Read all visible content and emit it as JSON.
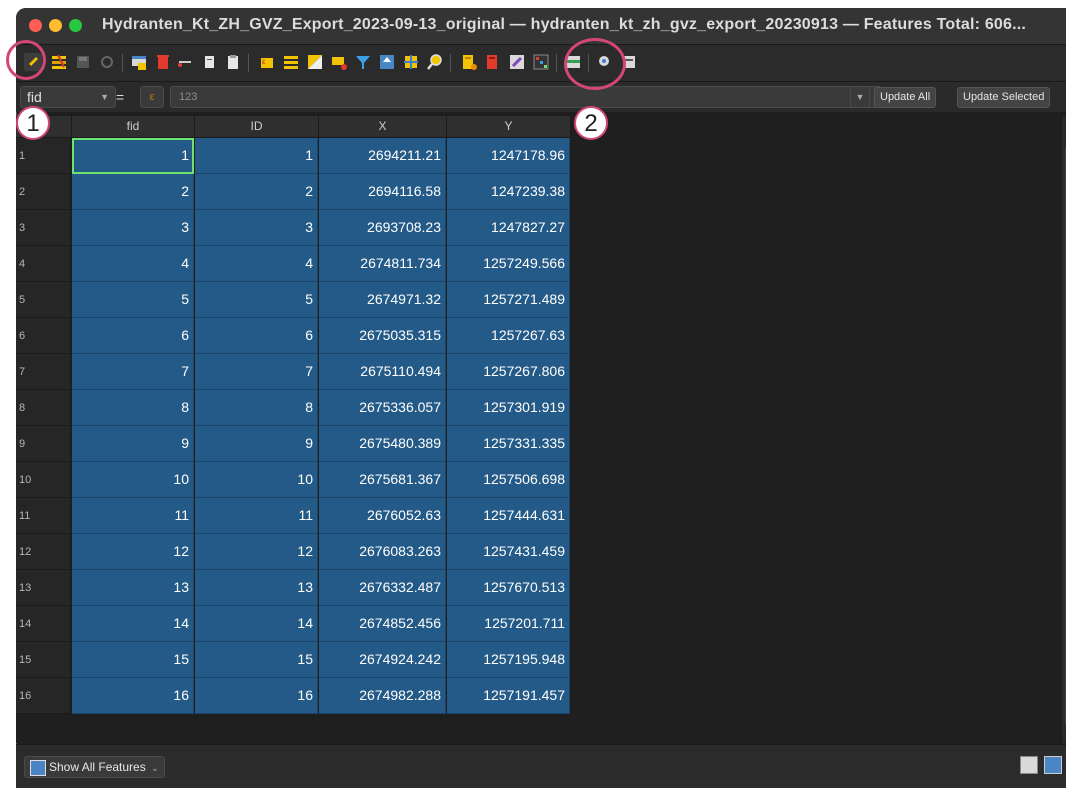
{
  "window": {
    "title": "Hydranten_Kt_ZH_GVZ_Export_2023-09-13_original — hydranten_kt_zh_gvz_export_20230913 — Features Total: 606..."
  },
  "toolbar": {
    "icons": [
      "edit-pencil-icon",
      "multi-edit-icon",
      "save-edits-icon",
      "reload-icon",
      "add-feature-icon",
      "delete-feature-icon",
      "cut-icon",
      "copy-icon",
      "paste-icon",
      "expression-select-icon",
      "select-all-icon",
      "invert-selection-icon",
      "deselect-icon",
      "filter-icon",
      "move-selection-top-icon",
      "pan-to-selected-icon",
      "zoom-to-selected-icon",
      "new-field-icon",
      "delete-field-icon",
      "field-calculator-icon",
      "conditional-formatting-icon",
      "dock-table-icon",
      "actions-icon",
      "form-view-icon"
    ]
  },
  "field_calc": {
    "field": "fid",
    "operator": "=",
    "expression_placeholder": "123",
    "update_all": "Update All",
    "update_selected": "Update Selected"
  },
  "table": {
    "columns": [
      "fid",
      "ID",
      "X",
      "Y"
    ],
    "rows": [
      {
        "n": "1",
        "fid": "1",
        "id": "1",
        "x": "2694211.21",
        "y": "1247178.96"
      },
      {
        "n": "2",
        "fid": "2",
        "id": "2",
        "x": "2694116.58",
        "y": "1247239.38"
      },
      {
        "n": "3",
        "fid": "3",
        "id": "3",
        "x": "2693708.23",
        "y": "1247827.27"
      },
      {
        "n": "4",
        "fid": "4",
        "id": "4",
        "x": "2674811.734",
        "y": "1257249.566"
      },
      {
        "n": "5",
        "fid": "5",
        "id": "5",
        "x": "2674971.32",
        "y": "1257271.489"
      },
      {
        "n": "6",
        "fid": "6",
        "id": "6",
        "x": "2675035.315",
        "y": "1257267.63"
      },
      {
        "n": "7",
        "fid": "7",
        "id": "7",
        "x": "2675110.494",
        "y": "1257267.806"
      },
      {
        "n": "8",
        "fid": "8",
        "id": "8",
        "x": "2675336.057",
        "y": "1257301.919"
      },
      {
        "n": "9",
        "fid": "9",
        "id": "9",
        "x": "2675480.389",
        "y": "1257331.335"
      },
      {
        "n": "10",
        "fid": "10",
        "id": "10",
        "x": "2675681.367",
        "y": "1257506.698"
      },
      {
        "n": "11",
        "fid": "11",
        "id": "11",
        "x": "2676052.63",
        "y": "1257444.631"
      },
      {
        "n": "12",
        "fid": "12",
        "id": "12",
        "x": "2676083.263",
        "y": "1257431.459"
      },
      {
        "n": "13",
        "fid": "13",
        "id": "13",
        "x": "2676332.487",
        "y": "1257670.513"
      },
      {
        "n": "14",
        "fid": "14",
        "id": "14",
        "x": "2674852.456",
        "y": "1257201.711"
      },
      {
        "n": "15",
        "fid": "15",
        "id": "15",
        "x": "2674924.242",
        "y": "1257195.948"
      },
      {
        "n": "16",
        "fid": "16",
        "id": "16",
        "x": "2674982.288",
        "y": "1257191.457"
      }
    ]
  },
  "bottom": {
    "show_all": "Show All Features"
  },
  "annotations": {
    "badge1": "1",
    "badge2": "2",
    "color": "#d4467a"
  },
  "colors": {
    "selected_cell": "#245a87",
    "focus_outline": "#6ee36e"
  }
}
